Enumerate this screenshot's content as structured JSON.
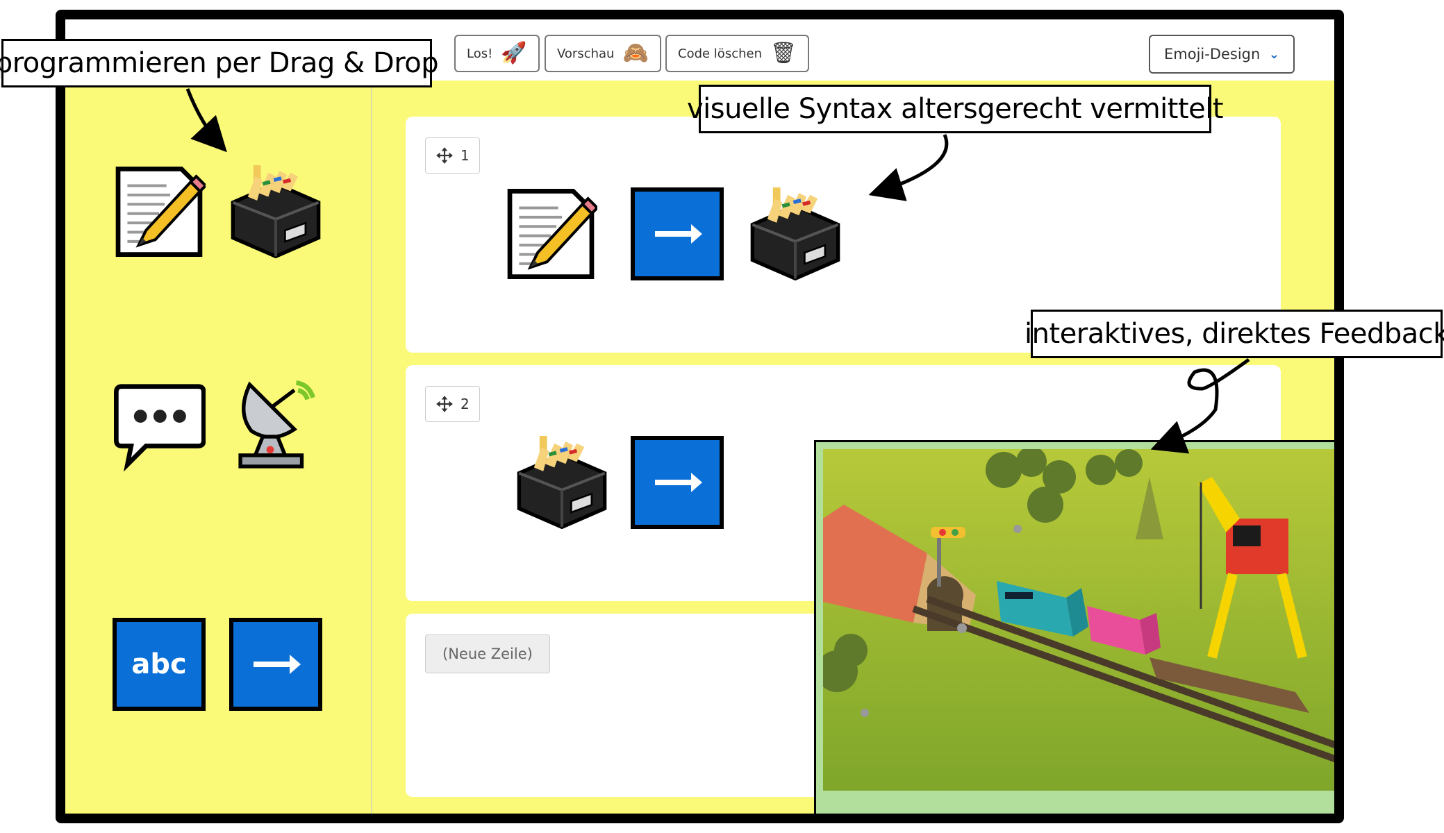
{
  "toolbar": {
    "run_label": "Los!",
    "preview_label": "Vorschau",
    "clear_label": "Code löschen",
    "run_emoji": "🚀",
    "preview_emoji": "🙈",
    "clear_emoji": "🗑"
  },
  "theme_select": {
    "selected": "Emoji-Design"
  },
  "palette": {
    "abc_label": "abc",
    "items": [
      "memo-icon",
      "card-file-box-icon",
      "speech-balloon-icon",
      "satellite-antenna-icon",
      "abc-block",
      "arrow-block"
    ]
  },
  "code_rows": [
    {
      "number": "1",
      "blocks": [
        "memo-icon",
        "arrow-block",
        "card-file-box-icon"
      ]
    },
    {
      "number": "2",
      "blocks": [
        "card-file-box-icon",
        "arrow-block"
      ]
    }
  ],
  "new_row_label": "(Neue Zeile)",
  "annotations": {
    "drag_drop": "programmieren per Drag & Drop",
    "syntax": "visuelle Syntax altersgerecht vermittelt",
    "feedback": "interaktives, direktes Feedback"
  },
  "colors": {
    "workspace": "#fbfa78",
    "block_blue": "#0a6fd6",
    "preview_bg": "#b2e09c"
  }
}
